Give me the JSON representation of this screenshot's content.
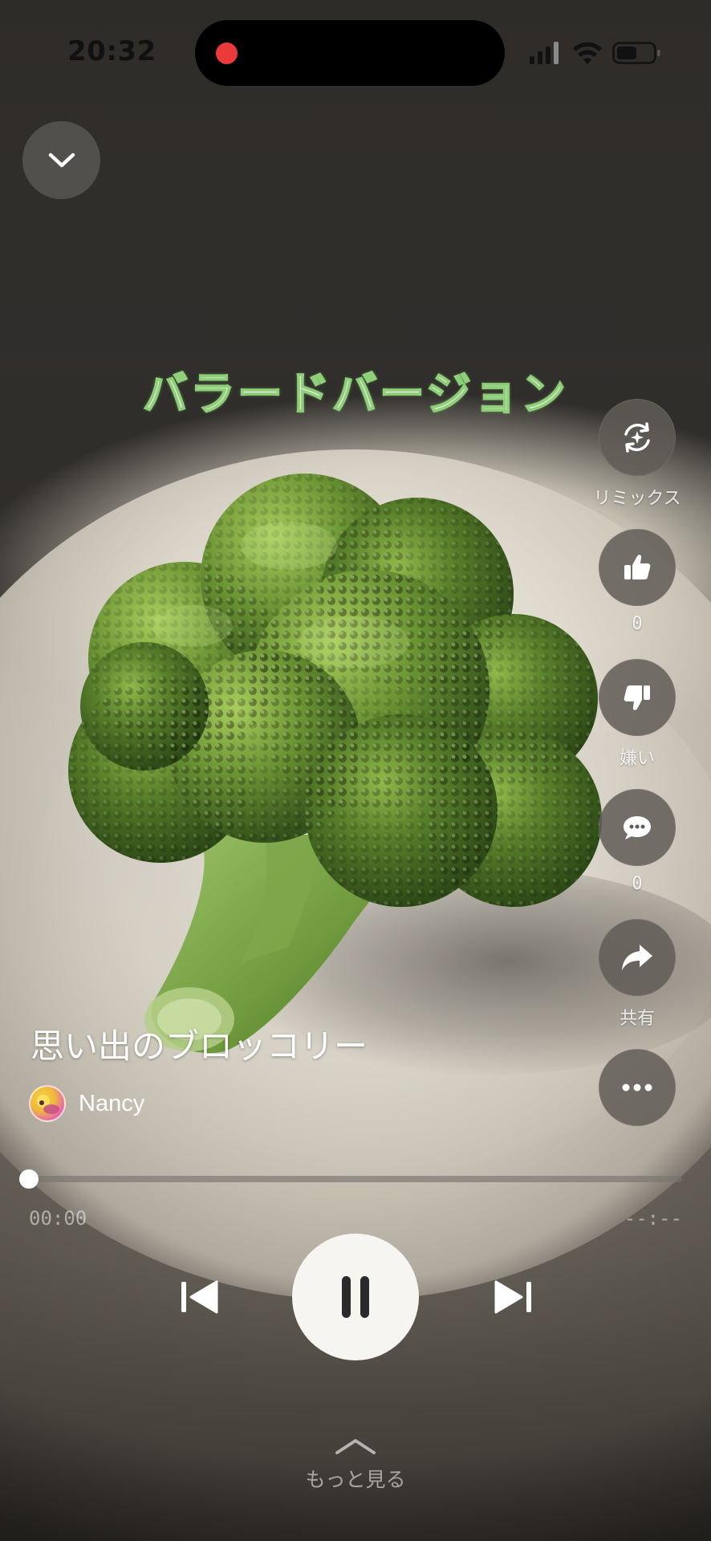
{
  "status_bar": {
    "time": "20:32"
  },
  "overlay": {
    "title": "バラードバージョン"
  },
  "actions": {
    "remix": {
      "label": "リミックス"
    },
    "like": {
      "count": "0"
    },
    "dislike": {
      "label": "嫌い"
    },
    "comment": {
      "count": "0"
    },
    "share": {
      "label": "共有"
    }
  },
  "song": {
    "title": "思い出のブロッコリー",
    "artist": "Nancy"
  },
  "player": {
    "progress": 0,
    "elapsed": "00:00",
    "total": "--:--",
    "state": "playing"
  },
  "more": {
    "label": "もっと見る"
  },
  "icons": {
    "collapse": "chevron-down-icon",
    "remix": "remix-icon",
    "like": "thumbs-up-icon",
    "dislike": "thumbs-down-icon",
    "comment": "comment-icon",
    "share": "share-icon",
    "more_options": "ellipsis-icon",
    "previous": "previous-track-icon",
    "pause": "pause-icon",
    "next": "next-track-icon"
  },
  "colors": {
    "record_dot": "#ea3a3a",
    "title_stroke": "#8fcf7a"
  }
}
